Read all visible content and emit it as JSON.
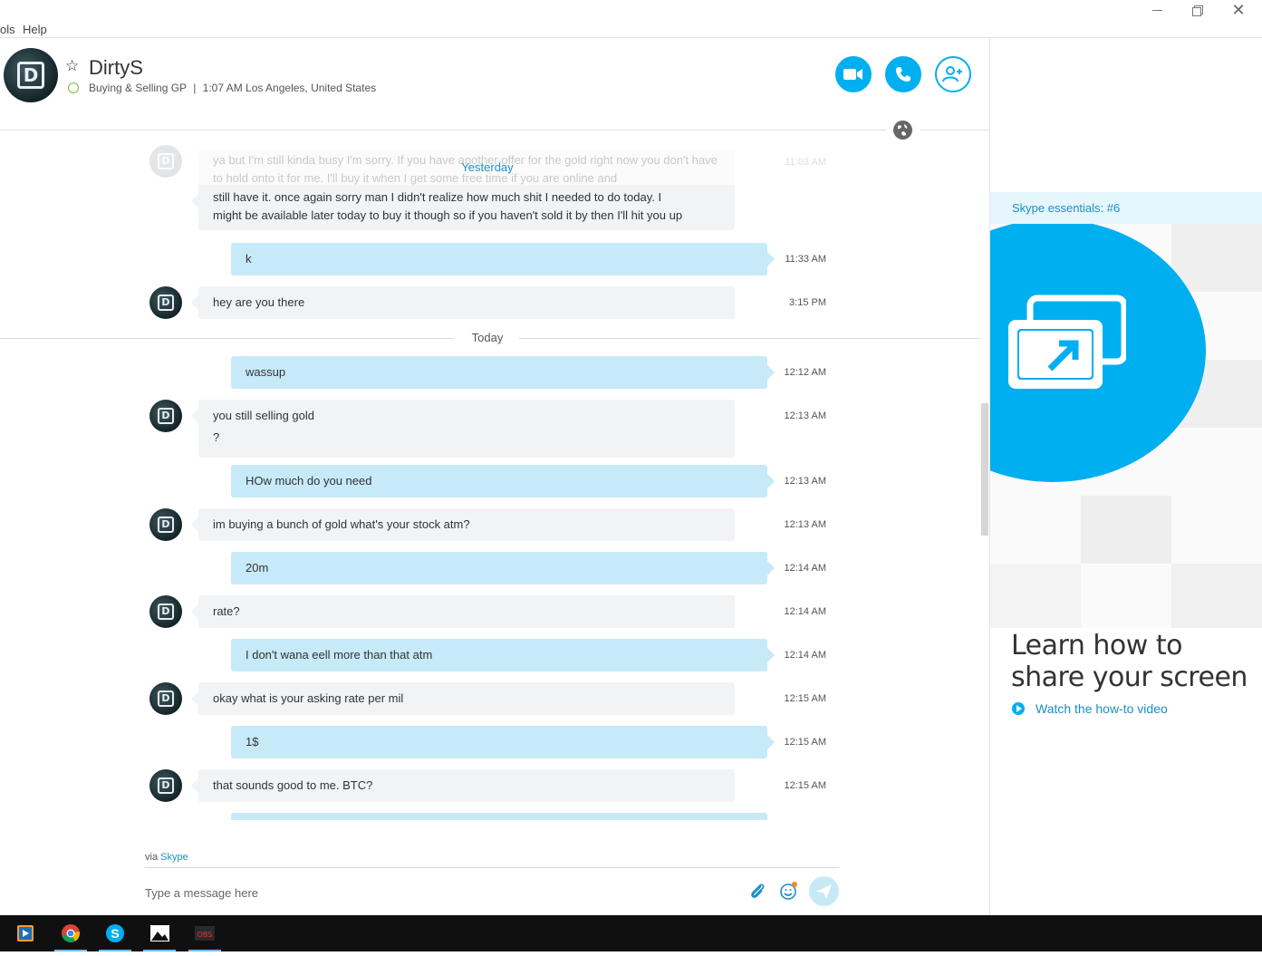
{
  "window": {
    "menu": [
      "ols",
      "Help"
    ]
  },
  "contact": {
    "name": "DirtyS",
    "mood": "Buying & Selling GP",
    "separator": "|",
    "local_time": "1:07 AM Los Angeles, United States",
    "avatar_letter": "D"
  },
  "header_buttons": [
    {
      "name": "video-call",
      "icon": "video-camera-icon"
    },
    {
      "name": "voice-call",
      "icon": "phone-icon"
    },
    {
      "name": "add-contact",
      "icon": "add-person-icon"
    }
  ],
  "chat": {
    "faded_text": "ya but I'm still kinda busy I'm sorry. If you have another offer for the gold right now you don't have to hold onto it for me. I'll buy it when I get some free time if you are online and",
    "faded_time": "11:03 AM",
    "day_yesterday": "Yesterday",
    "day_today": "Today",
    "messages": [
      {
        "dir": "in",
        "lines": [
          "still have it. once again sorry man I didn't realize how much shit I needed to do today. I",
          "might be available later today to buy it though so if you haven't sold it by then I'll hit you up"
        ],
        "time": ""
      },
      {
        "dir": "out",
        "lines": [
          "k"
        ],
        "time": "11:33 AM"
      },
      {
        "dir": "in",
        "lines": [
          "hey are you there"
        ],
        "time": "3:15 PM"
      },
      {
        "dir": "out",
        "lines": [
          "wassup"
        ],
        "time": "12:12 AM"
      },
      {
        "dir": "in",
        "lines": [
          "you still selling gold",
          "?"
        ],
        "time": "12:13 AM"
      },
      {
        "dir": "out",
        "lines": [
          "HOw much do you need"
        ],
        "time": "12:13 AM"
      },
      {
        "dir": "in",
        "lines": [
          "im buying a bunch of gold what's your stock atm?"
        ],
        "time": "12:13 AM"
      },
      {
        "dir": "out",
        "lines": [
          "20m"
        ],
        "time": "12:14 AM"
      },
      {
        "dir": "in",
        "lines": [
          "rate?"
        ],
        "time": "12:14 AM"
      },
      {
        "dir": "out",
        "lines": [
          "I don't wana eell more than that atm"
        ],
        "time": "12:14 AM"
      },
      {
        "dir": "in",
        "lines": [
          "okay what is your asking rate per mil"
        ],
        "time": "12:15 AM"
      },
      {
        "dir": "out",
        "lines": [
          "1$"
        ],
        "time": "12:15 AM"
      },
      {
        "dir": "in",
        "lines": [
          "that sounds good to me. BTC?"
        ],
        "time": "12:15 AM"
      }
    ]
  },
  "composer": {
    "via_prefix": "via ",
    "via_brand": "Skype",
    "placeholder": "Type a message here"
  },
  "promo": {
    "essentials": "Skype essentials: #6",
    "title_line1": "Learn how to",
    "title_line2": "share your screen",
    "link": "Watch the how-to video"
  },
  "taskbar": [
    {
      "name": "media-player",
      "icon": "media-player-icon"
    },
    {
      "name": "chrome",
      "icon": "chrome-icon"
    },
    {
      "name": "skype",
      "icon": "skype-icon"
    },
    {
      "name": "photos",
      "icon": "photos-icon"
    },
    {
      "name": "obs",
      "icon": "obs-icon"
    }
  ],
  "colors": {
    "accent": "#00aff0",
    "link": "#1a8fc9",
    "outgoing_bubble": "#c7eaf9",
    "incoming_bubble": "#f2f3f5",
    "presence": "#7cbf33"
  }
}
